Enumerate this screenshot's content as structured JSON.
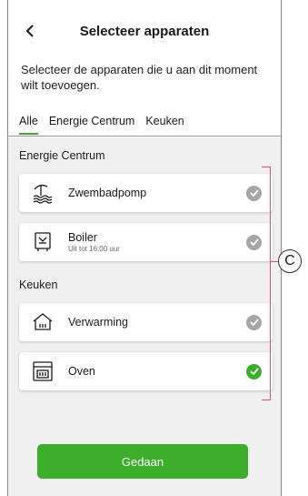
{
  "header": {
    "title": "Selecteer apparaten",
    "subtitle": "Selecteer de apparaten die u aan dit moment wilt toevoegen."
  },
  "tabs": [
    {
      "label": "Alle",
      "active": true
    },
    {
      "label": "Energie Centrum",
      "active": false
    },
    {
      "label": "Keuken",
      "active": false
    }
  ],
  "sections": [
    {
      "label": "Energie Centrum",
      "devices": [
        {
          "name": "Zwembadpomp",
          "sub": "",
          "icon": "pool-pump-icon",
          "selected": false
        },
        {
          "name": "Boiler",
          "sub": "Uit tot 16:00 uur",
          "icon": "boiler-icon",
          "selected": false
        }
      ]
    },
    {
      "label": "Keuken",
      "devices": [
        {
          "name": "Verwarming",
          "sub": "",
          "icon": "heating-icon",
          "selected": false
        },
        {
          "name": "Oven",
          "sub": "",
          "icon": "oven-icon",
          "selected": true
        }
      ]
    }
  ],
  "done_label": "Gedaan",
  "callout_label": "C",
  "colors": {
    "accent": "#3dae2b",
    "unchecked": "#a6a6a6",
    "bracket": "#e0506e"
  }
}
